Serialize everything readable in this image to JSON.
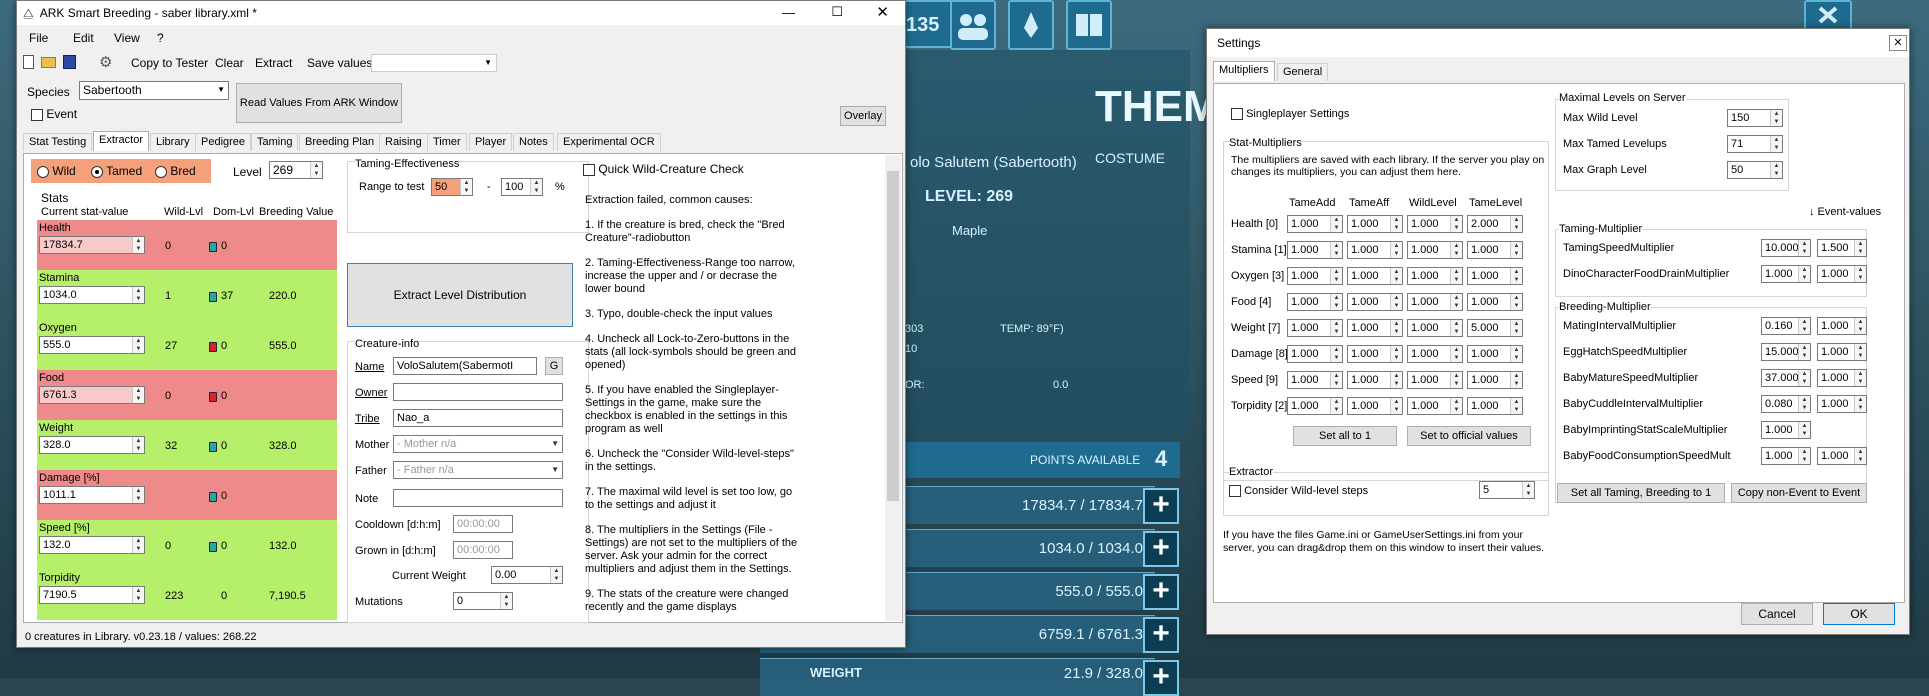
{
  "game": {
    "counter": "135",
    "creature_name": "olo Salutem (Sabertooth)",
    "level": "LEVEL: 269",
    "tribe_name": "Maple",
    "them": "THEM",
    "costume": "COSTUME",
    "temp": "TEMP: 89°F)",
    "torpor_label": "OR:",
    "torpor_value": "0.0",
    "points_label": "POINTS AVAILABLE",
    "points_value": "4",
    "bars": [
      "17834.7 / 17834.7",
      "1034.0 / 1034.0",
      "555.0 / 555.0",
      "6759.1 / 6761.3"
    ],
    "weight_label": "WEIGHT",
    "weight_value": "21.9 / 328.0",
    "side_numbers": [
      "303",
      "10"
    ]
  },
  "main": {
    "title": "ARK Smart Breeding - saber library.xml *",
    "menu": [
      "File",
      "Edit",
      "View",
      "?"
    ],
    "toolbar": {
      "copy_tester": "Copy to Tester",
      "clear": "Clear",
      "extract": "Extract",
      "save_values": "Save values"
    },
    "species_label": "Species",
    "species_value": "Sabertooth",
    "read_button": "Read Values From ARK Window",
    "overlay_button": "Overlay",
    "event_label": "Event",
    "tabs": [
      "Stat Testing",
      "Extractor",
      "Library",
      "Pedigree",
      "Taming",
      "Breeding Plan",
      "Raising",
      "Timer",
      "Player",
      "Notes",
      "Experimental OCR"
    ],
    "radios": {
      "wild": "Wild",
      "tamed": "Tamed",
      "bred": "Bred"
    },
    "level_label": "Level",
    "level_value": "269",
    "stats_title": "Stats",
    "col_headers": {
      "current": "Current stat-value",
      "wild": "Wild-Lvl",
      "dom": "Dom-Lvl",
      "breeding": "Breeding Value"
    },
    "stats": [
      {
        "name": "Health",
        "value": "17834.7",
        "wild": "0",
        "dom": "0",
        "breed": ""
      },
      {
        "name": "Stamina",
        "value": "1034.0",
        "wild": "1",
        "dom": "37",
        "breed": "220.0"
      },
      {
        "name": "Oxygen",
        "value": "555.0",
        "wild": "27",
        "dom": "0",
        "breed": "555.0"
      },
      {
        "name": "Food",
        "value": "6761.3",
        "wild": "0",
        "dom": "0",
        "breed": ""
      },
      {
        "name": "Weight",
        "value": "328.0",
        "wild": "32",
        "dom": "0",
        "breed": "328.0"
      },
      {
        "name": "Damage [%]",
        "value": "1011.1",
        "wild": "",
        "dom": "0",
        "breed": ""
      },
      {
        "name": "Speed [%]",
        "value": "132.0",
        "wild": "0",
        "dom": "0",
        "breed": "132.0"
      },
      {
        "name": "Torpidity",
        "value": "7190.5",
        "wild": "223",
        "dom": "0",
        "breed": "7,190.5"
      }
    ],
    "te_title": "Taming-Effectiveness",
    "range_label": "Range to test",
    "range_min": "50",
    "range_dash": "-",
    "range_max": "100",
    "pct": "%",
    "extract_dist": "Extract Level Distribution",
    "quick_check": "Quick Wild-Creature Check",
    "help_text": [
      "Extraction failed, common causes:",
      "1. If the creature is bred, check the \"Bred Creature\"-radiobutton",
      "2. Taming-Effectiveness-Range too narrow, increase the upper and / or decrase the lower bound",
      "3. Typo, double-check the input values",
      "4. Uncheck all Lock-to-Zero-buttons in the stats (all lock-symbols should be green and opened)",
      "5. If you have enabled the Singleplayer-Settings in the game, make sure the checkbox is enabled in the settings in this program as well",
      "6. Uncheck the \"Consider Wild-level-steps\" in the settings.",
      "7. The maximal wild level is set too low, go to the settings and adjust it",
      "8. The multipliers in the Settings (File - Settings) are not set to the multipliers of the server. Ask your admin for the correct multipliers and adjust them in the Settings.",
      "9. The stats of the creature were changed recently and the game displays"
    ],
    "creature_info": "Creature-info",
    "name_label": "Name",
    "name_value": "VoloSalutem(SabermotI",
    "g_button": "G",
    "owner_label": "Owner",
    "tribe_label": "Tribe",
    "tribe_value": "Nao_a",
    "mother_label": "Mother",
    "mother_value": "- Mother n/a",
    "father_label": "Father",
    "father_value": "- Father n/a",
    "note_label": "Note",
    "cooldown_label": "Cooldown [d:h:m]",
    "cooldown_value": "00:00:00",
    "grown_label": "Grown in [d:h:m]",
    "grown_value": "00:00:00",
    "cw_label": "Current Weight",
    "cw_value": "0.00",
    "mutations_label": "Mutations",
    "mutations_value": "0",
    "status": "0 creatures in Library. v0.23.18 / values: 268.22"
  },
  "settings": {
    "title": "Settings",
    "tabs": [
      "Multipliers",
      "General"
    ],
    "singleplayer": "Singleplayer Settings",
    "stat_mult_title": "Stat-Multipliers",
    "stat_mult_desc": "The multipliers are saved with each library. If the server you play on changes its multipliers, you can adjust them here.",
    "cols": [
      "TameAdd",
      "TameAff",
      "WildLevel",
      "TameLevel"
    ],
    "rows": [
      {
        "name": "Health [0]",
        "v": [
          "1.000",
          "1.000",
          "1.000",
          "2.000"
        ]
      },
      {
        "name": "Stamina [1]",
        "v": [
          "1.000",
          "1.000",
          "1.000",
          "1.000"
        ]
      },
      {
        "name": "Oxygen [3]",
        "v": [
          "1.000",
          "1.000",
          "1.000",
          "1.000"
        ]
      },
      {
        "name": "Food [4]",
        "v": [
          "1.000",
          "1.000",
          "1.000",
          "1.000"
        ]
      },
      {
        "name": "Weight [7]",
        "v": [
          "1.000",
          "1.000",
          "1.000",
          "5.000"
        ]
      },
      {
        "name": "Damage [8]",
        "v": [
          "1.000",
          "1.000",
          "1.000",
          "1.000"
        ]
      },
      {
        "name": "Speed [9]",
        "v": [
          "1.000",
          "1.000",
          "1.000",
          "1.000"
        ]
      },
      {
        "name": "Torpidity [2]",
        "v": [
          "1.000",
          "1.000",
          "1.000",
          "1.000"
        ]
      }
    ],
    "set_all_1": "Set all to 1",
    "set_official": "Set to official values",
    "extractor_title": "Extractor",
    "wild_steps": "Consider Wild-level steps",
    "wild_steps_value": "5",
    "ini_text": "If you have the files Game.ini or GameUserSettings.ini from your server, you can drag&drop them on this window to insert their values.",
    "max_title": "Maximal Levels on Server",
    "max_rows": [
      {
        "name": "Max Wild Level",
        "v": "150"
      },
      {
        "name": "Max Tamed Levelups",
        "v": "71"
      },
      {
        "name": "Max Graph Level",
        "v": "50"
      }
    ],
    "event_values": "↓ Event-values",
    "taming_title": "Taming-Multiplier",
    "taming_rows": [
      {
        "name": "TamingSpeedMultiplier",
        "v": "10.000",
        "e": "1.500"
      },
      {
        "name": "DinoCharacterFoodDrainMultiplier",
        "v": "1.000",
        "e": "1.000"
      }
    ],
    "breeding_title": "Breeding-Multiplier",
    "breeding_rows": [
      {
        "name": "MatingIntervalMultiplier",
        "v": "0.160",
        "e": "1.000"
      },
      {
        "name": "EggHatchSpeedMultiplier",
        "v": "15.000",
        "e": "1.000"
      },
      {
        "name": "BabyMatureSpeedMultiplier",
        "v": "37.000",
        "e": "1.000"
      },
      {
        "name": "BabyCuddleIntervalMultiplier",
        "v": "0.080",
        "e": "1.000"
      },
      {
        "name": "BabyImprintingStatScaleMultiplier",
        "v": "1.000",
        "e": ""
      },
      {
        "name": "BabyFoodConsumptionSpeedMult",
        "v": "1.000",
        "e": "1.000"
      }
    ],
    "set_taming_1": "Set all Taming, Breeding to 1",
    "copy_event": "Copy non-Event to Event",
    "cancel": "Cancel",
    "ok": "OK"
  }
}
